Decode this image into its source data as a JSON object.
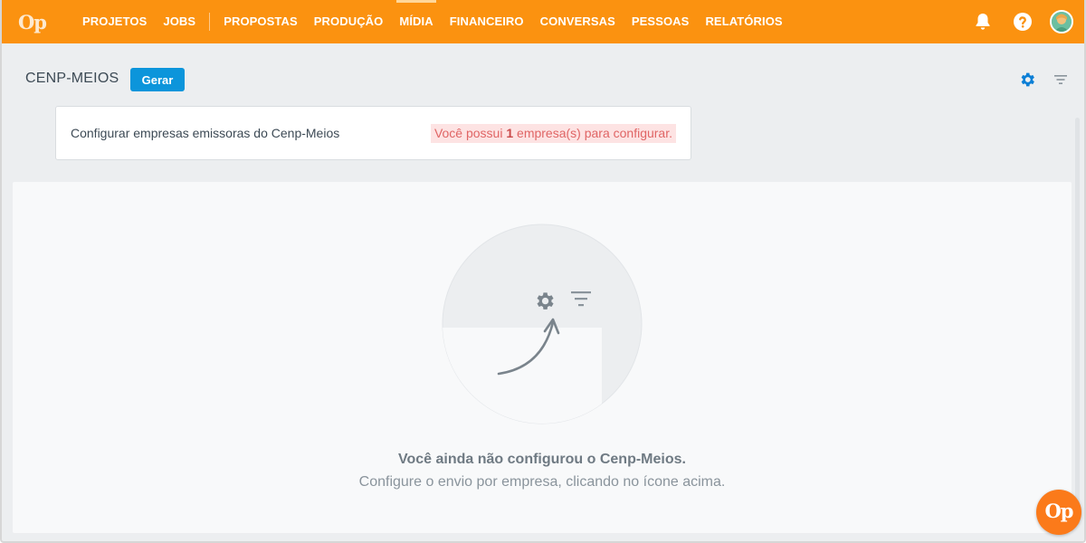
{
  "app": {
    "logo_text": "Op",
    "brand_color": "#fb9210"
  },
  "nav": {
    "items": [
      {
        "label": "PROJETOS"
      },
      {
        "label": "JOBS"
      },
      {
        "label": "PROPOSTAS"
      },
      {
        "label": "PRODUÇÃO"
      },
      {
        "label": "MÍDIA",
        "active": true
      },
      {
        "label": "FINANCEIRO"
      },
      {
        "label": "CONVERSAS"
      },
      {
        "label": "PESSOAS"
      },
      {
        "label": "RELATÓRIOS"
      }
    ],
    "right_icons": [
      "bell-icon",
      "help-icon",
      "user-avatar"
    ]
  },
  "page": {
    "title": "CENP-MEIOS",
    "generate_button": "Gerar",
    "accent_color": "#0c95db",
    "header_icons": [
      "gear-icon",
      "filter-icon"
    ]
  },
  "config_card": {
    "label": "Configurar empresas emissoras do Cenp-Meios",
    "warning_prefix": "Você possui ",
    "warning_count": "1",
    "warning_suffix": " empresa(s) para configurar."
  },
  "empty_state": {
    "title": "Você ainda não configurou o Cenp-Meios.",
    "subtitle": "Configure o envio por empresa, clicando no ícone acima.",
    "illustration_icons": [
      "gear-icon",
      "filter-icon",
      "arrow-icon"
    ]
  },
  "fab": {
    "label": "Op",
    "color": "#fb7a1a"
  }
}
